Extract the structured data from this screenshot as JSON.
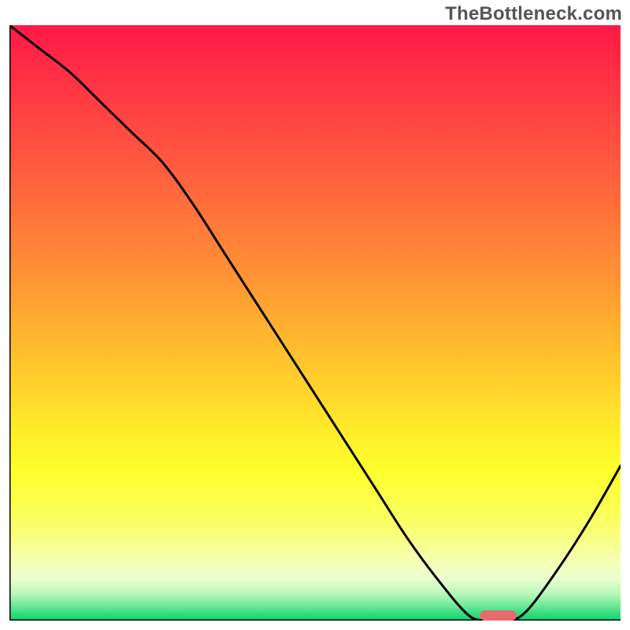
{
  "watermark": "TheBottleneck.com",
  "chart_data": {
    "type": "line",
    "title": "",
    "xlabel": "",
    "ylabel": "",
    "xlim": [
      0,
      100
    ],
    "ylim": [
      0,
      100
    ],
    "grid": false,
    "legend": false,
    "x": [
      0,
      5,
      10,
      15,
      20,
      25,
      30,
      35,
      40,
      45,
      50,
      55,
      60,
      65,
      70,
      75,
      78,
      82,
      85,
      90,
      95,
      100
    ],
    "values": [
      100,
      96,
      92,
      87,
      82,
      77,
      70,
      62,
      54,
      46,
      38,
      30,
      22,
      14,
      7,
      1,
      0,
      0,
      2,
      9,
      17,
      26
    ],
    "marker": {
      "x": 80,
      "y": 0,
      "width": 6,
      "height": 1.7,
      "color": "#e86a6f"
    },
    "background_gradient": {
      "stops": [
        {
          "offset": 0.0,
          "color": "#ff1947"
        },
        {
          "offset": 0.1,
          "color": "#ff3444"
        },
        {
          "offset": 0.2,
          "color": "#ff5040"
        },
        {
          "offset": 0.3,
          "color": "#ff6e3b"
        },
        {
          "offset": 0.4,
          "color": "#ff8c36"
        },
        {
          "offset": 0.45,
          "color": "#ff9d33"
        },
        {
          "offset": 0.5,
          "color": "#ffae30"
        },
        {
          "offset": 0.55,
          "color": "#ffbf2e"
        },
        {
          "offset": 0.6,
          "color": "#ffd02c"
        },
        {
          "offset": 0.65,
          "color": "#ffe12b"
        },
        {
          "offset": 0.7,
          "color": "#fff22a"
        },
        {
          "offset": 0.75,
          "color": "#feff2c"
        },
        {
          "offset": 0.8,
          "color": "#fbff4a"
        },
        {
          "offset": 0.85,
          "color": "#f9ff73"
        },
        {
          "offset": 0.9,
          "color": "#f5ffb2"
        },
        {
          "offset": 0.93,
          "color": "#e9ffcf"
        },
        {
          "offset": 0.955,
          "color": "#baf7bb"
        },
        {
          "offset": 0.975,
          "color": "#6de996"
        },
        {
          "offset": 0.99,
          "color": "#2edc7e"
        },
        {
          "offset": 1.0,
          "color": "#14d671"
        }
      ]
    }
  }
}
